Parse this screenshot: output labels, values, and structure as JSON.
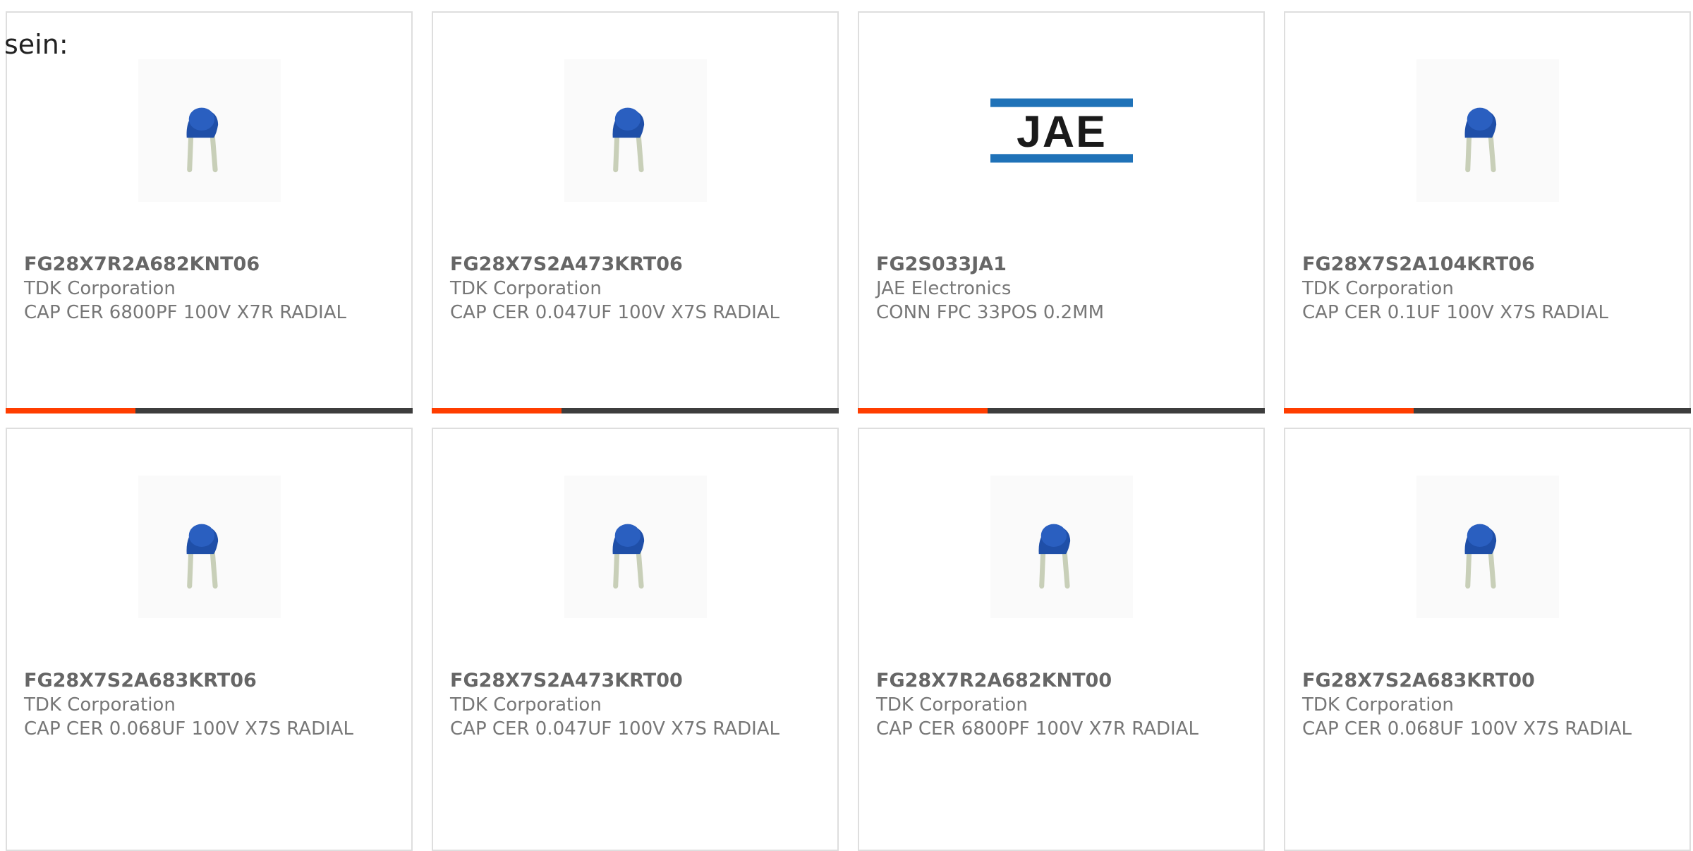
{
  "intro_text": "sein:",
  "colors": {
    "accent": "#ff3d00",
    "bar": "#3d3d3d",
    "capacitor_blue": "#1f4fa8",
    "jae_blue": "#1f72b8"
  },
  "products": [
    {
      "part": "FG28X7R2A682KNT06",
      "maker": "TDK Corporation",
      "desc": "CAP CER 6800PF 100V X7R RADIAL",
      "image": "capacitor-image"
    },
    {
      "part": "FG28X7S2A473KRT06",
      "maker": "TDK Corporation",
      "desc": "CAP CER 0.047UF 100V X7S RADIAL",
      "image": "capacitor-image"
    },
    {
      "part": "FG2S033JA1",
      "maker": "JAE Electronics",
      "desc": "CONN FPC 33POS 0.2MM",
      "image": "jae-logo",
      "logo_text": "JAE"
    },
    {
      "part": "FG28X7S2A104KRT06",
      "maker": "TDK Corporation",
      "desc": "CAP CER 0.1UF 100V X7S RADIAL",
      "image": "capacitor-image"
    },
    {
      "part": "FG28X7S2A683KRT06",
      "maker": "TDK Corporation",
      "desc": "CAP CER 0.068UF 100V X7S RADIAL",
      "image": "capacitor-image"
    },
    {
      "part": "FG28X7S2A473KRT00",
      "maker": "TDK Corporation",
      "desc": "CAP CER 0.047UF 100V X7S RADIAL",
      "image": "capacitor-image"
    },
    {
      "part": "FG28X7R2A682KNT00",
      "maker": "TDK Corporation",
      "desc": "CAP CER 6800PF 100V X7R RADIAL",
      "image": "capacitor-image"
    },
    {
      "part": "FG28X7S2A683KRT00",
      "maker": "TDK Corporation",
      "desc": "CAP CER 0.068UF 100V X7S RADIAL",
      "image": "capacitor-image"
    }
  ]
}
